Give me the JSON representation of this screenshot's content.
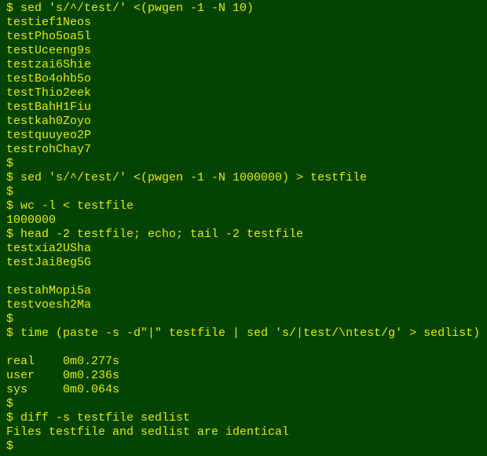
{
  "terminal": {
    "colors": {
      "background": "#004400",
      "foreground": "#e8e800"
    },
    "lines": [
      "$ sed 's/^/test/' <(pwgen -1 -N 10)",
      "testief1Neos",
      "testPho5oa5l",
      "testUceeng9s",
      "testzai6Shie",
      "testBo4ohb5o",
      "testThio2eek",
      "testBahH1Fiu",
      "testkah0Zoyo",
      "testquuyeo2P",
      "testrohChay7",
      "$",
      "$ sed 's/^/test/' <(pwgen -1 -N 1000000) > testfile",
      "$",
      "$ wc -l < testfile",
      "1000000",
      "$ head -2 testfile; echo; tail -2 testfile",
      "testxia2USha",
      "testJai8eg5G",
      "",
      "testahMopi5a",
      "testvoesh2Ma",
      "$",
      "$ time (paste -s -d\"|\" testfile | sed 's/|test/\\ntest/g' > sedlist)",
      "",
      "real    0m0.277s",
      "user    0m0.236s",
      "sys     0m0.064s",
      "$",
      "$ diff -s testfile sedlist",
      "Files testfile and sedlist are identical",
      "$"
    ]
  }
}
